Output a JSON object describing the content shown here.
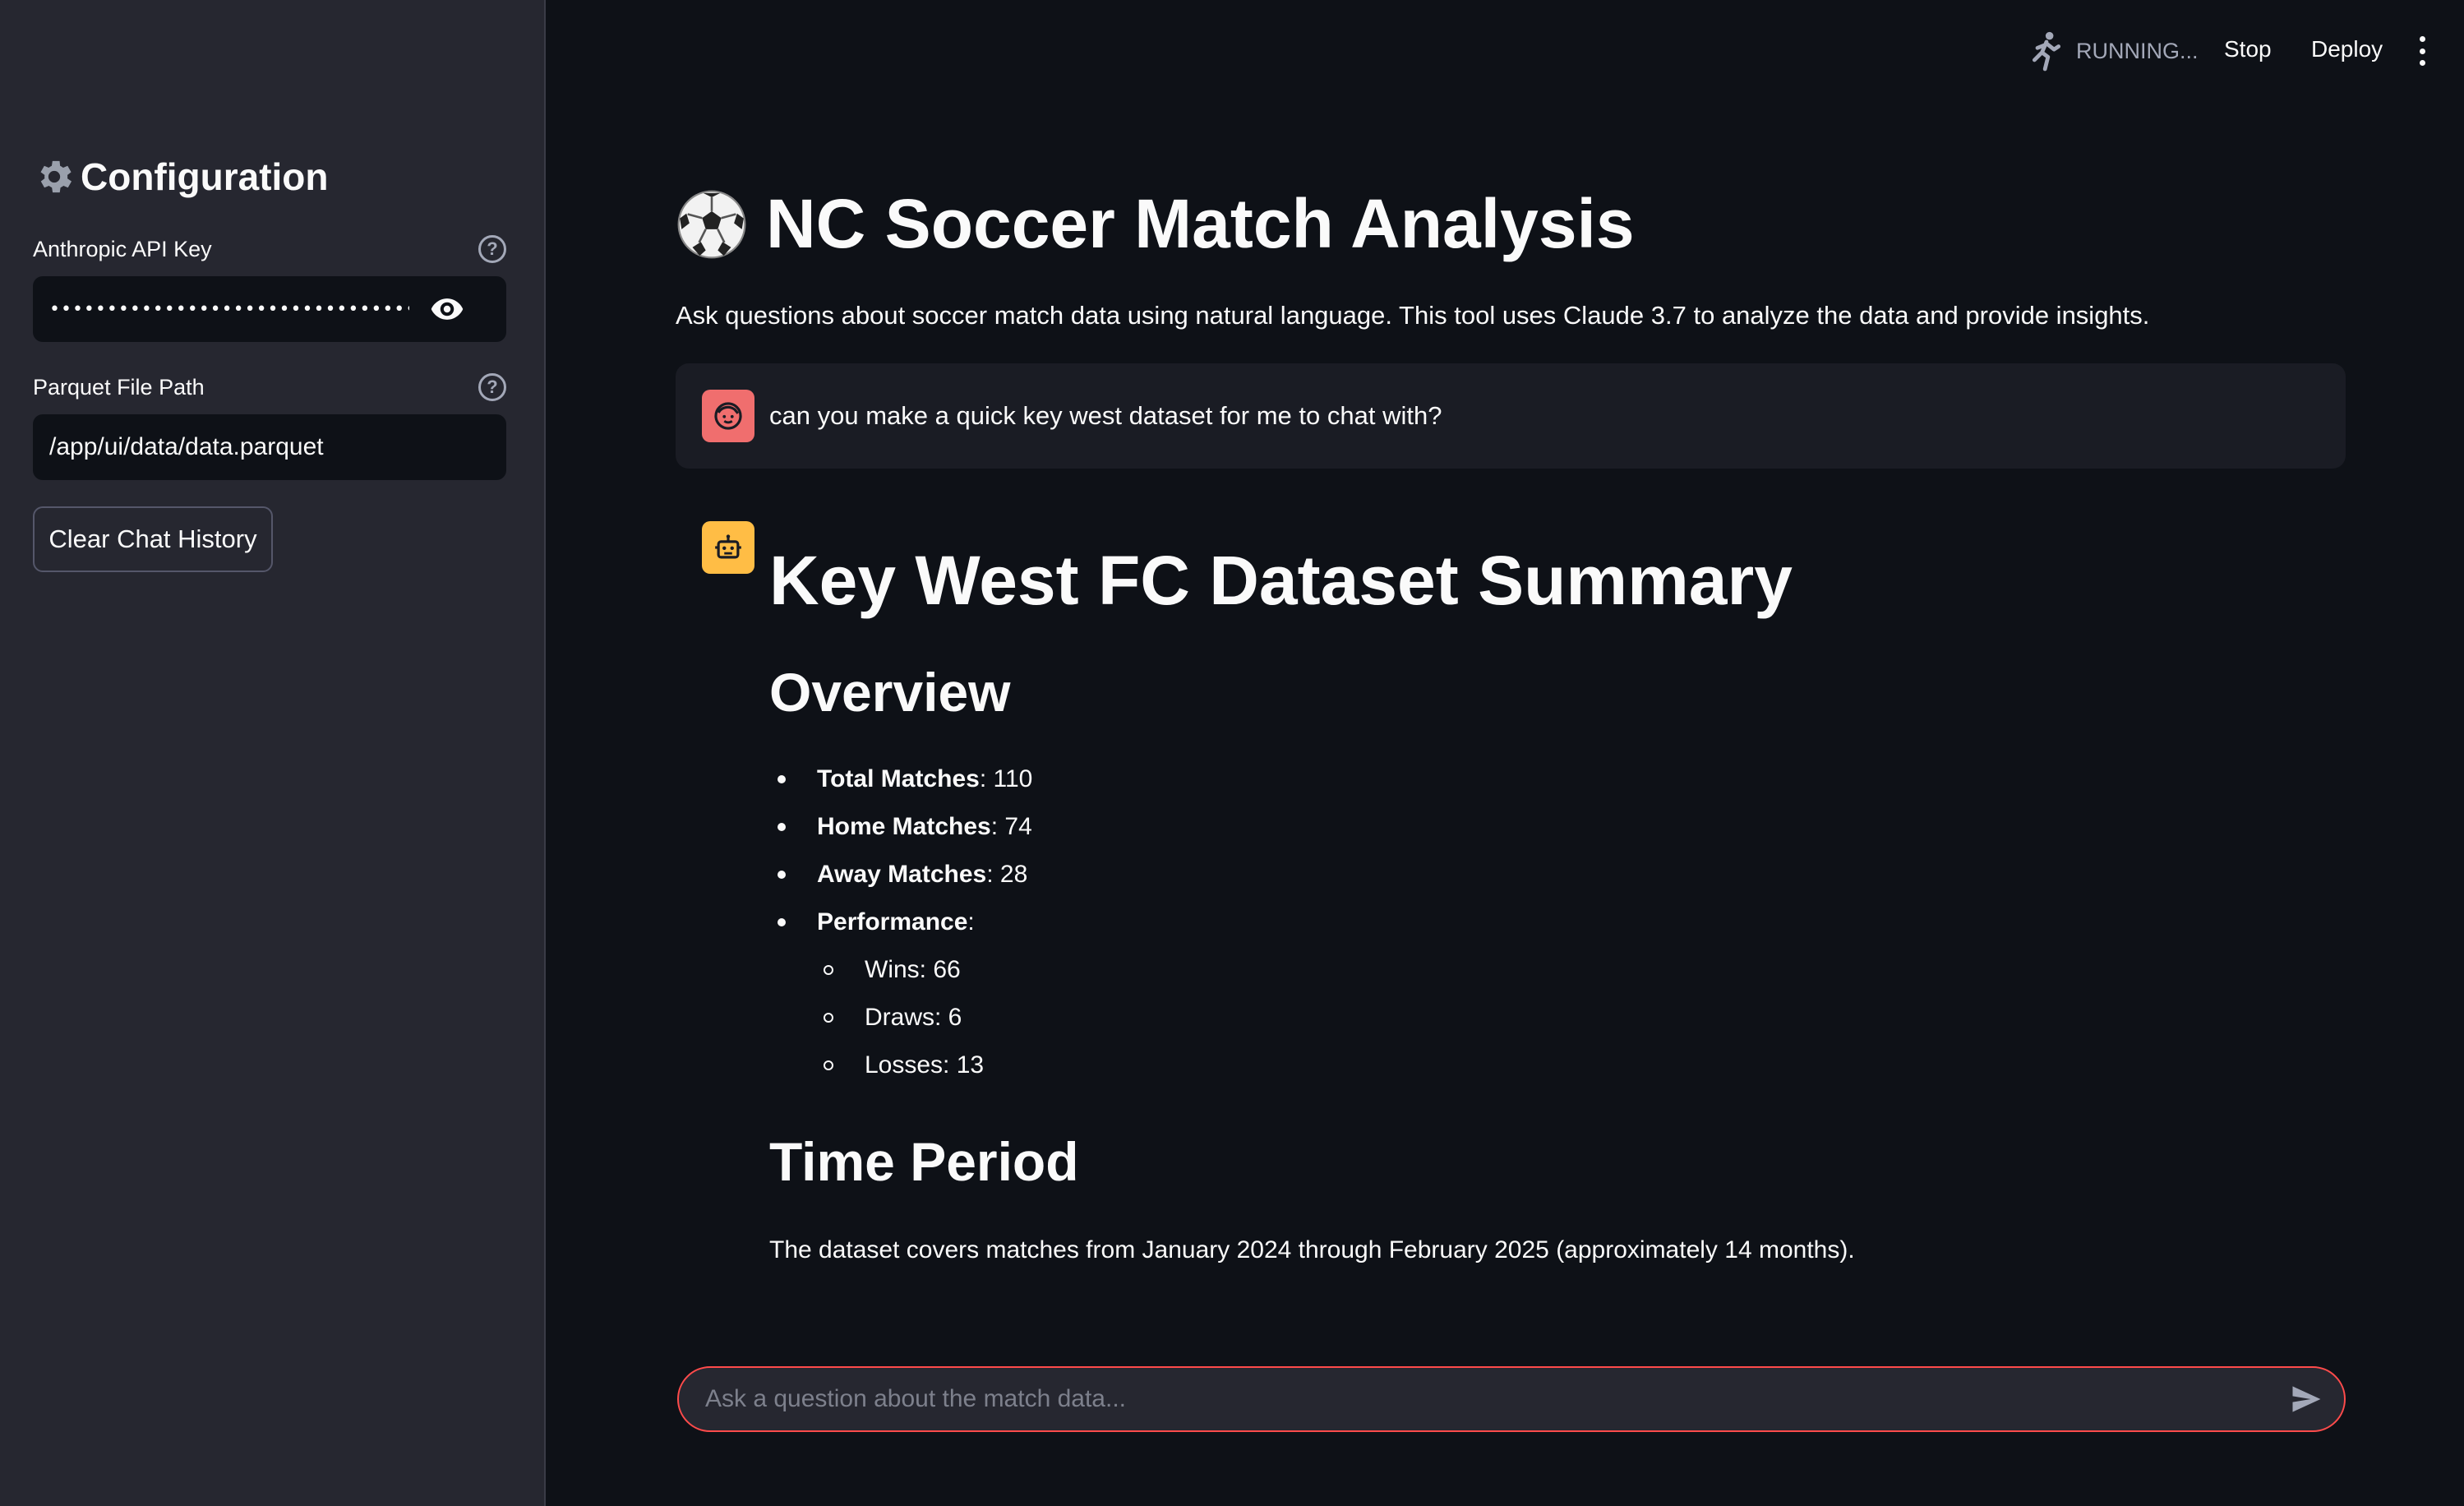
{
  "sidebar": {
    "title": "Configuration",
    "api_key_label": "Anthropic API Key",
    "api_key_value": "••••••••••••••••••••••••••••••••••••••••••••••••••••",
    "parquet_label": "Parquet File Path",
    "parquet_value": "/app/ui/data/data.parquet",
    "clear_button": "Clear Chat History"
  },
  "header": {
    "status": "RUNNING...",
    "stop_label": "Stop",
    "deploy_label": "Deploy"
  },
  "main": {
    "title": "NC Soccer Match Analysis",
    "description": "Ask questions about soccer match data using natural language. This tool uses Claude 3.7 to analyze the data and provide insights."
  },
  "chat": {
    "user_message": "can you make a quick key west dataset for me to chat with?",
    "assistant": {
      "heading": "Key West FC Dataset Summary",
      "overview_heading": "Overview",
      "items": [
        {
          "label": "Total Matches",
          "value": ": 110"
        },
        {
          "label": "Home Matches",
          "value": ": 74"
        },
        {
          "label": "Away Matches",
          "value": ": 28"
        },
        {
          "label": "Performance",
          "value": ":"
        }
      ],
      "performance": [
        "Wins: 66",
        "Draws: 6",
        "Losses: 13"
      ],
      "period_heading": "Time Period",
      "period_text": "The dataset covers matches from January 2024 through February 2025 (approximately 14 months)."
    },
    "input_placeholder": "Ask a question about the match data..."
  },
  "colors": {
    "background": "#0e1117",
    "sidebar": "#262730",
    "accent": "#ff4b4b",
    "user_avatar": "#f06e6e",
    "bot_avatar": "#ffbd45"
  }
}
